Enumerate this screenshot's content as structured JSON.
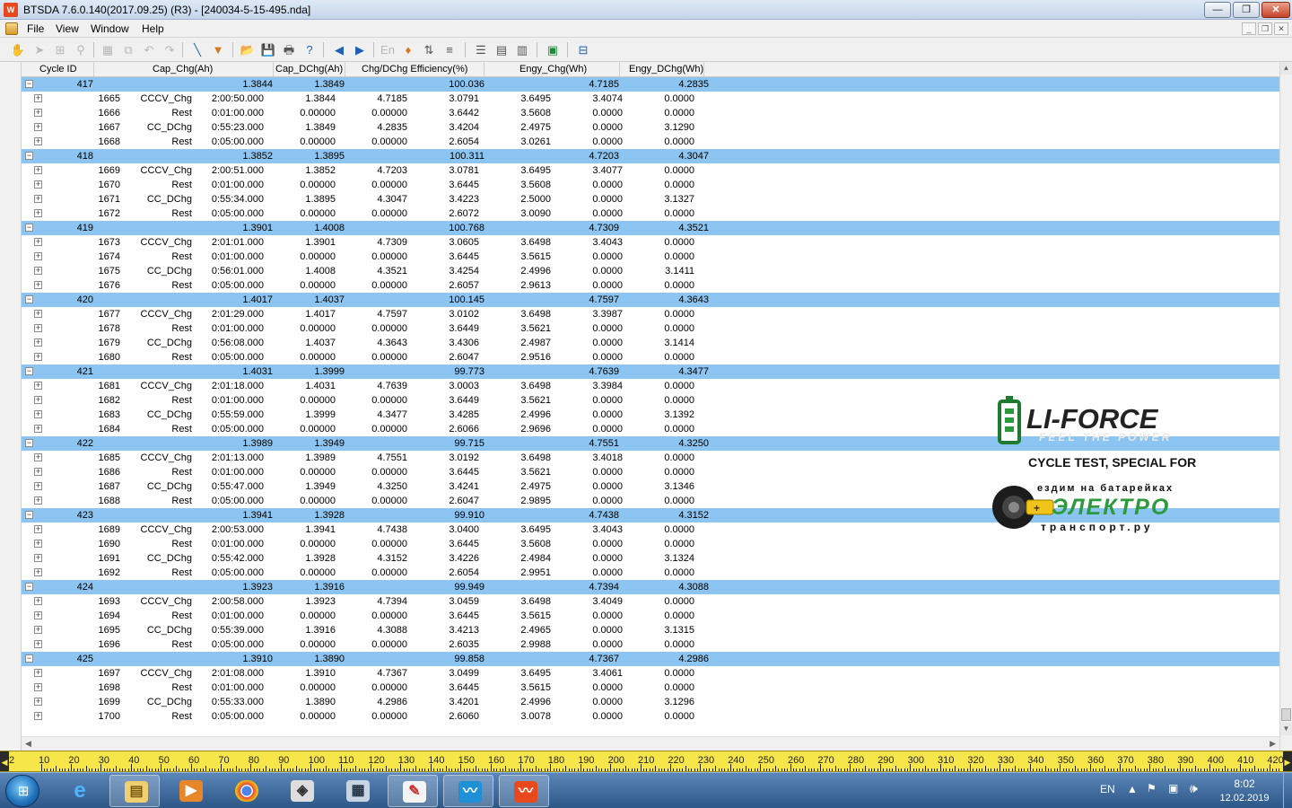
{
  "window": {
    "title": "BTSDA 7.6.0.140(2017.09.25) (R3) - [240034-5-15-495.nda]",
    "app_icon": "app-logo-icon"
  },
  "menu": {
    "items": [
      "File",
      "View",
      "Window",
      "Help"
    ]
  },
  "columns": [
    "Cycle ID",
    "Cap_Chg(Ah)",
    "Cap_DChg(Ah)",
    "Chg/DChg Efficiency(%)",
    "Engy_Chg(Wh)",
    "Engy_DChg(Wh)"
  ],
  "cycles": [
    {
      "id": "417",
      "cap_chg": "1.3844",
      "cap_dchg": "1.3849",
      "eff": "100.036",
      "e_chg": "4.7185",
      "e_dchg": "4.2835",
      "steps": [
        [
          "1665",
          "CCCV_Chg",
          "2:00:50.000",
          "1.3844",
          "4.7185",
          "3.0791",
          "3.6495",
          "3.4074",
          "0.0000"
        ],
        [
          "1666",
          "Rest",
          "0:01:00.000",
          "0.00000",
          "0.00000",
          "3.6442",
          "3.5608",
          "0.0000",
          "0.0000"
        ],
        [
          "1667",
          "CC_DChg",
          "0:55:23.000",
          "1.3849",
          "4.2835",
          "3.4204",
          "2.4975",
          "0.0000",
          "3.1290"
        ],
        [
          "1668",
          "Rest",
          "0:05:00.000",
          "0.00000",
          "0.00000",
          "2.6054",
          "3.0261",
          "0.0000",
          "0.0000"
        ]
      ]
    },
    {
      "id": "418",
      "cap_chg": "1.3852",
      "cap_dchg": "1.3895",
      "eff": "100.311",
      "e_chg": "4.7203",
      "e_dchg": "4.3047",
      "steps": [
        [
          "1669",
          "CCCV_Chg",
          "2:00:51.000",
          "1.3852",
          "4.7203",
          "3.0781",
          "3.6495",
          "3.4077",
          "0.0000"
        ],
        [
          "1670",
          "Rest",
          "0:01:00.000",
          "0.00000",
          "0.00000",
          "3.6445",
          "3.5608",
          "0.0000",
          "0.0000"
        ],
        [
          "1671",
          "CC_DChg",
          "0:55:34.000",
          "1.3895",
          "4.3047",
          "3.4223",
          "2.5000",
          "0.0000",
          "3.1327"
        ],
        [
          "1672",
          "Rest",
          "0:05:00.000",
          "0.00000",
          "0.00000",
          "2.6072",
          "3.0090",
          "0.0000",
          "0.0000"
        ]
      ]
    },
    {
      "id": "419",
      "cap_chg": "1.3901",
      "cap_dchg": "1.4008",
      "eff": "100.768",
      "e_chg": "4.7309",
      "e_dchg": "4.3521",
      "steps": [
        [
          "1673",
          "CCCV_Chg",
          "2:01:01.000",
          "1.3901",
          "4.7309",
          "3.0605",
          "3.6498",
          "3.4043",
          "0.0000"
        ],
        [
          "1674",
          "Rest",
          "0:01:00.000",
          "0.00000",
          "0.00000",
          "3.6445",
          "3.5615",
          "0.0000",
          "0.0000"
        ],
        [
          "1675",
          "CC_DChg",
          "0:56:01.000",
          "1.4008",
          "4.3521",
          "3.4254",
          "2.4996",
          "0.0000",
          "3.1411"
        ],
        [
          "1676",
          "Rest",
          "0:05:00.000",
          "0.00000",
          "0.00000",
          "2.6057",
          "2.9613",
          "0.0000",
          "0.0000"
        ]
      ]
    },
    {
      "id": "420",
      "cap_chg": "1.4017",
      "cap_dchg": "1.4037",
      "eff": "100.145",
      "e_chg": "4.7597",
      "e_dchg": "4.3643",
      "steps": [
        [
          "1677",
          "CCCV_Chg",
          "2:01:29.000",
          "1.4017",
          "4.7597",
          "3.0102",
          "3.6498",
          "3.3987",
          "0.0000"
        ],
        [
          "1678",
          "Rest",
          "0:01:00.000",
          "0.00000",
          "0.00000",
          "3.6449",
          "3.5621",
          "0.0000",
          "0.0000"
        ],
        [
          "1679",
          "CC_DChg",
          "0:56:08.000",
          "1.4037",
          "4.3643",
          "3.4306",
          "2.4987",
          "0.0000",
          "3.1414"
        ],
        [
          "1680",
          "Rest",
          "0:05:00.000",
          "0.00000",
          "0.00000",
          "2.6047",
          "2.9516",
          "0.0000",
          "0.0000"
        ]
      ]
    },
    {
      "id": "421",
      "cap_chg": "1.4031",
      "cap_dchg": "1.3999",
      "eff": "99.773",
      "e_chg": "4.7639",
      "e_dchg": "4.3477",
      "steps": [
        [
          "1681",
          "CCCV_Chg",
          "2:01:18.000",
          "1.4031",
          "4.7639",
          "3.0003",
          "3.6498",
          "3.3984",
          "0.0000"
        ],
        [
          "1682",
          "Rest",
          "0:01:00.000",
          "0.00000",
          "0.00000",
          "3.6449",
          "3.5621",
          "0.0000",
          "0.0000"
        ],
        [
          "1683",
          "CC_DChg",
          "0:55:59.000",
          "1.3999",
          "4.3477",
          "3.4285",
          "2.4996",
          "0.0000",
          "3.1392"
        ],
        [
          "1684",
          "Rest",
          "0:05:00.000",
          "0.00000",
          "0.00000",
          "2.6066",
          "2.9696",
          "0.0000",
          "0.0000"
        ]
      ]
    },
    {
      "id": "422",
      "cap_chg": "1.3989",
      "cap_dchg": "1.3949",
      "eff": "99.715",
      "e_chg": "4.7551",
      "e_dchg": "4.3250",
      "steps": [
        [
          "1685",
          "CCCV_Chg",
          "2:01:13.000",
          "1.3989",
          "4.7551",
          "3.0192",
          "3.6498",
          "3.4018",
          "0.0000"
        ],
        [
          "1686",
          "Rest",
          "0:01:00.000",
          "0.00000",
          "0.00000",
          "3.6445",
          "3.5621",
          "0.0000",
          "0.0000"
        ],
        [
          "1687",
          "CC_DChg",
          "0:55:47.000",
          "1.3949",
          "4.3250",
          "3.4241",
          "2.4975",
          "0.0000",
          "3.1346"
        ],
        [
          "1688",
          "Rest",
          "0:05:00.000",
          "0.00000",
          "0.00000",
          "2.6047",
          "2.9895",
          "0.0000",
          "0.0000"
        ]
      ]
    },
    {
      "id": "423",
      "cap_chg": "1.3941",
      "cap_dchg": "1.3928",
      "eff": "99.910",
      "e_chg": "4.7438",
      "e_dchg": "4.3152",
      "steps": [
        [
          "1689",
          "CCCV_Chg",
          "2:00:53.000",
          "1.3941",
          "4.7438",
          "3.0400",
          "3.6495",
          "3.4043",
          "0.0000"
        ],
        [
          "1690",
          "Rest",
          "0:01:00.000",
          "0.00000",
          "0.00000",
          "3.6445",
          "3.5608",
          "0.0000",
          "0.0000"
        ],
        [
          "1691",
          "CC_DChg",
          "0:55:42.000",
          "1.3928",
          "4.3152",
          "3.4226",
          "2.4984",
          "0.0000",
          "3.1324"
        ],
        [
          "1692",
          "Rest",
          "0:05:00.000",
          "0.00000",
          "0.00000",
          "2.6054",
          "2.9951",
          "0.0000",
          "0.0000"
        ]
      ]
    },
    {
      "id": "424",
      "cap_chg": "1.3923",
      "cap_dchg": "1.3916",
      "eff": "99.949",
      "e_chg": "4.7394",
      "e_dchg": "4.3088",
      "steps": [
        [
          "1693",
          "CCCV_Chg",
          "2:00:58.000",
          "1.3923",
          "4.7394",
          "3.0459",
          "3.6498",
          "3.4049",
          "0.0000"
        ],
        [
          "1694",
          "Rest",
          "0:01:00.000",
          "0.00000",
          "0.00000",
          "3.6445",
          "3.5615",
          "0.0000",
          "0.0000"
        ],
        [
          "1695",
          "CC_DChg",
          "0:55:39.000",
          "1.3916",
          "4.3088",
          "3.4213",
          "2.4965",
          "0.0000",
          "3.1315"
        ],
        [
          "1696",
          "Rest",
          "0:05:00.000",
          "0.00000",
          "0.00000",
          "2.6035",
          "2.9988",
          "0.0000",
          "0.0000"
        ]
      ]
    },
    {
      "id": "425",
      "cap_chg": "1.3910",
      "cap_dchg": "1.3890",
      "eff": "99.858",
      "e_chg": "4.7367",
      "e_dchg": "4.2986",
      "steps": [
        [
          "1697",
          "CCCV_Chg",
          "2:01:08.000",
          "1.3910",
          "4.7367",
          "3.0499",
          "3.6495",
          "3.4061",
          "0.0000"
        ],
        [
          "1698",
          "Rest",
          "0:01:00.000",
          "0.00000",
          "0.00000",
          "3.6445",
          "3.5615",
          "0.0000",
          "0.0000"
        ],
        [
          "1699",
          "CC_DChg",
          "0:55:33.000",
          "1.3890",
          "4.2986",
          "3.4201",
          "2.4996",
          "0.0000",
          "3.1296"
        ],
        [
          "1700",
          "Rest",
          "0:05:00.000",
          "0.00000",
          "0.00000",
          "2.6060",
          "3.0078",
          "0.0000",
          "0.0000"
        ]
      ]
    }
  ],
  "ruler": {
    "labels": [
      "2",
      "10",
      "20",
      "30",
      "40",
      "50",
      "60",
      "70",
      "80",
      "90",
      "100",
      "110",
      "120",
      "130",
      "140",
      "150",
      "160",
      "170",
      "180",
      "190",
      "200",
      "210",
      "220",
      "230",
      "240",
      "250",
      "260",
      "270",
      "280",
      "290",
      "300",
      "310",
      "320",
      "330",
      "340",
      "350",
      "360",
      "370",
      "380",
      "390",
      "400",
      "410",
      "420"
    ],
    "color": "#f7e64a"
  },
  "overlay": {
    "brand": "LI-FORCE",
    "tagline": "FEEL THE POWER",
    "caption": "CYCLE TEST, SPECIAL FOR",
    "partner_top": "ездим на батарейках",
    "partner_mid": "ЭЛЕКТРО",
    "partner_bot": "транспорт.ру"
  },
  "taskbar": {
    "apps": [
      "start-orb",
      "internet-explorer-icon",
      "file-explorer-icon",
      "media-player-icon",
      "chrome-icon",
      "package-icon",
      "calculator-icon",
      "paint-icon",
      "battery-tester-icon",
      "btsda-icon"
    ],
    "lang": "EN",
    "time": "8:02",
    "date": "12.02.2019"
  },
  "colors": {
    "cycle_row": "#8cc4f2",
    "taskbar": "#2c5786"
  }
}
